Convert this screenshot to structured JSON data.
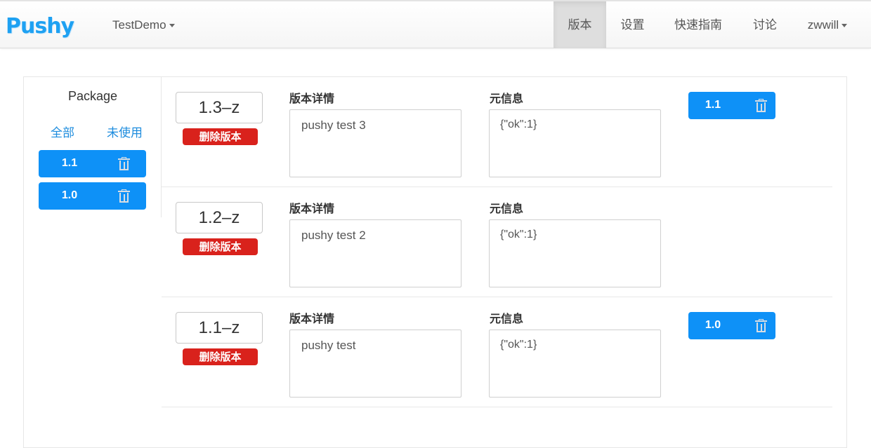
{
  "navbar": {
    "brand": "Pushy",
    "app_selector": "TestDemo",
    "items": [
      {
        "label": "版本",
        "active": true
      },
      {
        "label": "设置",
        "active": false
      },
      {
        "label": "快速指南",
        "active": false
      },
      {
        "label": "讨论",
        "active": false
      }
    ],
    "user": "zwwill"
  },
  "sidebar": {
    "title": "Package",
    "filters": [
      "全部",
      "未使用"
    ],
    "packages": [
      "1.1",
      "1.0"
    ]
  },
  "versions": [
    {
      "name": "1.3–z",
      "delete_label": "删除版本",
      "desc_label": "版本详情",
      "description": "pushy test 3",
      "meta_label": "元信息",
      "meta": "{\"ok\":1}",
      "package": "1.1"
    },
    {
      "name": "1.2–z",
      "delete_label": "删除版本",
      "desc_label": "版本详情",
      "description": "pushy test 2",
      "meta_label": "元信息",
      "meta": "{\"ok\":1}",
      "package": null
    },
    {
      "name": "1.1–z",
      "delete_label": "删除版本",
      "desc_label": "版本详情",
      "description": "pushy test",
      "meta_label": "元信息",
      "meta": "{\"ok\":1}",
      "package": "1.0"
    }
  ],
  "colors": {
    "brand": "#1ea1f2",
    "primary": "#0e91f7",
    "danger": "#d9221c",
    "link": "#1d8cde"
  },
  "icons": {
    "delete": "trash-icon",
    "dropdown": "caret-down-icon"
  }
}
